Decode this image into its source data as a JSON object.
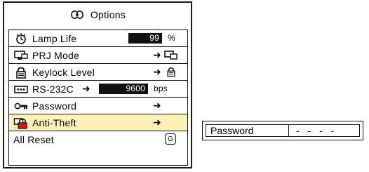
{
  "options_title": "Options",
  "menu": {
    "items": [
      {
        "label": "Lamp Life",
        "value": "99",
        "unit": "%"
      },
      {
        "label": "PRJ Mode",
        "arrow": "➜"
      },
      {
        "label": "Keylock Level",
        "arrow": "➜"
      },
      {
        "label": "RS-232C",
        "arrow": "➜",
        "value": "9600",
        "unit": "bps"
      },
      {
        "label": "Password",
        "arrow": "➜"
      },
      {
        "label": "Anti-Theft",
        "arrow": "➜"
      },
      {
        "label": "All Reset",
        "badge": "G"
      }
    ],
    "selected_index": 5
  },
  "password_panel": {
    "label": "Password",
    "value": "- - - -"
  },
  "colors": {
    "selected_row": "#fff2b8",
    "value_box": "#111111"
  }
}
